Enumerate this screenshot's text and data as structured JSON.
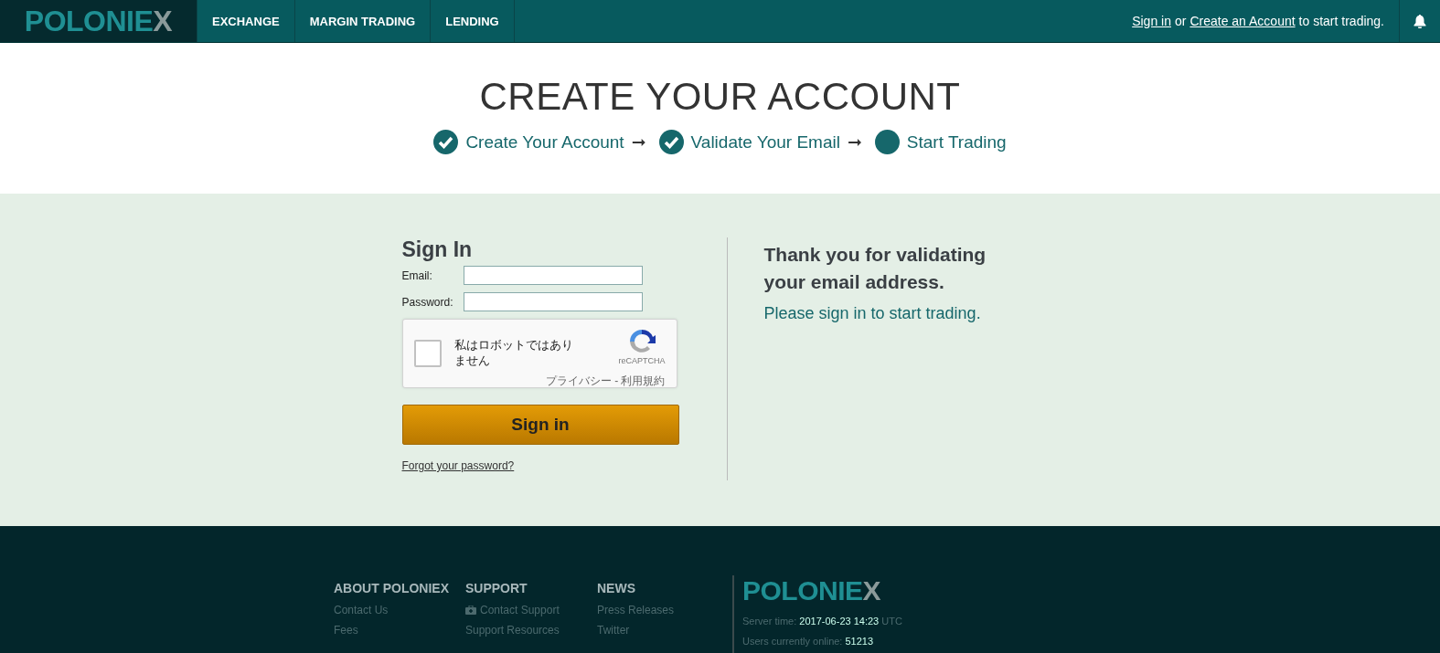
{
  "header": {
    "logo": "POLONIEX",
    "nav": [
      {
        "label": "EXCHANGE",
        "selected": false
      },
      {
        "label": "MARGIN TRADING",
        "selected": false
      },
      {
        "label": "LENDING",
        "selected": false
      }
    ],
    "account": {
      "signin": "Sign in",
      "or": "or",
      "create": "Create an Account",
      "suffix": "to start trading."
    }
  },
  "hero": {
    "title": "CREATE YOUR ACCOUNT",
    "steps": [
      {
        "label": "Create Your Account",
        "done": true,
        "arrow": "➞"
      },
      {
        "label": "Validate Your Email",
        "done": true,
        "arrow": "➞"
      },
      {
        "label": "Start Trading",
        "done": false
      }
    ]
  },
  "signin": {
    "title": "Sign In",
    "fields": [
      {
        "label": "Email:"
      },
      {
        "label": "Password:"
      }
    ],
    "captcha": {
      "label": "私はロボットではありません",
      "checked": false,
      "brand": "reCAPTCHA",
      "terms": "プライバシー - 利用規約"
    },
    "button": "Sign in",
    "forgot": "Forgot your password?"
  },
  "message": {
    "title": "Thank you for validating your email address.",
    "text": "Please sign in to start trading."
  },
  "footer": {
    "columns": [
      {
        "title": "ABOUT POLONIEX",
        "links": [
          {
            "label": "Contact Us"
          },
          {
            "label": "Fees"
          }
        ]
      },
      {
        "title": "SUPPORT",
        "links": [
          {
            "label": "Contact Support",
            "icon": true
          },
          {
            "label": "Support Resources"
          }
        ]
      },
      {
        "title": "NEWS",
        "links": [
          {
            "label": "Press Releases"
          },
          {
            "label": "Twitter"
          }
        ]
      }
    ],
    "logo": "POLONIEX",
    "server_label": "Server time:",
    "server_time": "2017-06-23 14:23",
    "server_tz": "UTC",
    "users_label": "Users currently online:",
    "users": "51213"
  }
}
